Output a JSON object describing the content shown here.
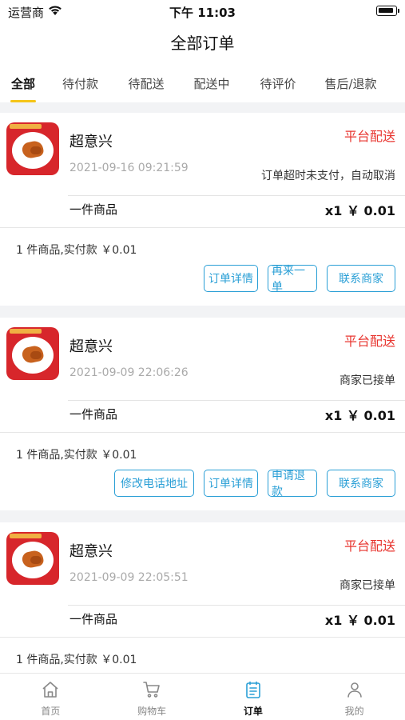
{
  "status_bar": {
    "carrier": "运营商",
    "time": "下午 11:03"
  },
  "header": {
    "title": "全部订单"
  },
  "tabs": [
    {
      "label": "全部",
      "active": true
    },
    {
      "label": "待付款"
    },
    {
      "label": "待配送"
    },
    {
      "label": "配送中"
    },
    {
      "label": "待评价"
    },
    {
      "label": "售后/退款"
    }
  ],
  "orders": [
    {
      "shop_name": "超意兴",
      "delivery_type": "平台配送",
      "time": "2021-09-16 09:21:59",
      "status": "订单超时未支付，自动取消",
      "goods_label": "一件商品",
      "goods_price": "x1 ￥ 0.01",
      "summary": "1 件商品,实付款 ￥0.01",
      "actions": [
        "订单详情",
        "再来一单",
        "联系商家"
      ]
    },
    {
      "shop_name": "超意兴",
      "delivery_type": "平台配送",
      "time": "2021-09-09 22:06:26",
      "status": "商家已接单",
      "goods_label": "一件商品",
      "goods_price": "x1 ￥ 0.01",
      "summary": "1 件商品,实付款 ￥0.01",
      "actions": [
        "修改电话地址",
        "订单详情",
        "申请退款",
        "联系商家"
      ]
    },
    {
      "shop_name": "超意兴",
      "delivery_type": "平台配送",
      "time": "2021-09-09 22:05:51",
      "status": "商家已接单",
      "goods_label": "一件商品",
      "goods_price": "x1 ￥ 0.01",
      "summary": "1 件商品,实付款 ￥0.01"
    }
  ],
  "bottom_nav": [
    {
      "label": "首页",
      "icon": "home-icon"
    },
    {
      "label": "购物车",
      "icon": "cart-icon"
    },
    {
      "label": "订单",
      "icon": "order-icon",
      "active": true
    },
    {
      "label": "我的",
      "icon": "user-icon"
    }
  ],
  "colors": {
    "accent": "#2a9fd6",
    "tab_underline": "#f5c518",
    "delivery": "#e8352f"
  }
}
